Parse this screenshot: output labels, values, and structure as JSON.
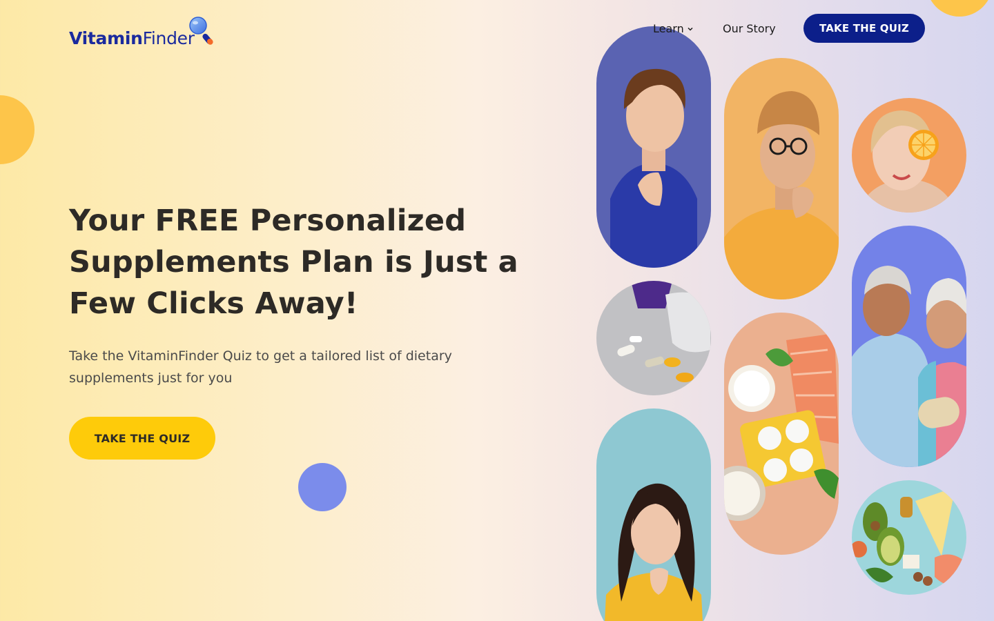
{
  "brand": {
    "name_bold": "Vitamin",
    "name_regular": "Finder",
    "icon": "magnifier-pill-icon"
  },
  "nav": {
    "learn_label": "Learn",
    "story_label": "Our Story",
    "cta_label": "TAKE THE QUIZ"
  },
  "hero": {
    "title": "Your FREE Personalized Supplements Plan is Just a Few Clicks Away!",
    "subtitle": "Take the VitaminFinder Quiz to get a tailored list of dietary supplements just for you",
    "cta_label": "TAKE THE QUIZ"
  },
  "colors": {
    "brand_blue": "#0c1f8a",
    "accent_yellow": "#fecb0a",
    "blob_yellow": "#fdc54a",
    "blob_blue": "#7b8ceb"
  }
}
